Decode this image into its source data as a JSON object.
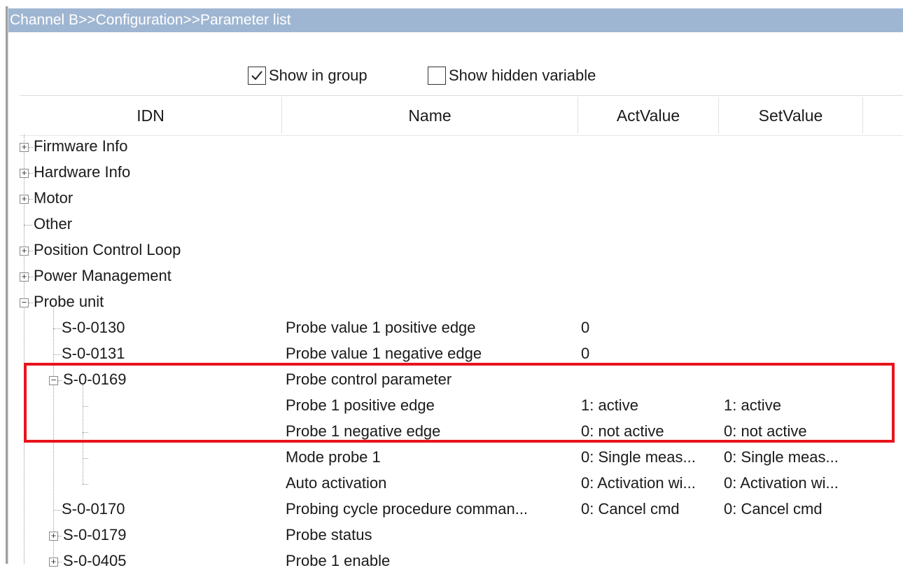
{
  "window": {
    "breadcrumb": "Channel B>>Configuration>>Parameter list"
  },
  "options": {
    "show_in_group": {
      "label": "Show in group",
      "checked": true
    },
    "show_hidden": {
      "label": "Show hidden variable",
      "checked": false
    }
  },
  "columns": {
    "idn": "IDN",
    "name": "Name",
    "act": "ActValue",
    "set": "SetValue"
  },
  "tree": {
    "firmware": {
      "label": "Firmware Info"
    },
    "hardware": {
      "label": "Hardware Info"
    },
    "motor": {
      "label": "Motor"
    },
    "other": {
      "label": "Other"
    },
    "position": {
      "label": "Position Control Loop"
    },
    "power": {
      "label": "Power Management"
    },
    "probe_unit": {
      "label": "Probe unit"
    },
    "s0130": {
      "idn": "S-0-0130",
      "name": "Probe value 1 positive edge",
      "act": "0",
      "set": ""
    },
    "s0131": {
      "idn": "S-0-0131",
      "name": "Probe value 1 negative edge",
      "act": "0",
      "set": ""
    },
    "s0169": {
      "idn": "S-0-0169",
      "name": "Probe control parameter",
      "act": "",
      "set": ""
    },
    "s0169_1": {
      "idn": "",
      "name": "Probe 1 positive edge",
      "act": "1: active",
      "set": "1: active"
    },
    "s0169_2": {
      "idn": "",
      "name": "Probe 1 negative edge",
      "act": "0: not active",
      "set": "0: not active"
    },
    "s0169_3": {
      "idn": "",
      "name": "Mode probe 1",
      "act": "0: Single meas...",
      "set": "0: Single meas..."
    },
    "s0169_4": {
      "idn": "",
      "name": "Auto activation",
      "act": "0: Activation wi...",
      "set": "0: Activation wi..."
    },
    "s0170": {
      "idn": "S-0-0170",
      "name": "Probing cycle procedure comman...",
      "act": "0: Cancel cmd",
      "set": "0: Cancel cmd"
    },
    "s0179": {
      "idn": "S-0-0179",
      "name": "Probe status",
      "act": "",
      "set": ""
    },
    "s0405": {
      "idn": "S-0-0405",
      "name": "Probe 1 enable",
      "act": "",
      "set": ""
    }
  },
  "icons": {
    "expand": "plus-box-icon",
    "collapse": "minus-box-icon",
    "check": "checkmark-icon"
  },
  "colors": {
    "title_bar": "#9fb6d2",
    "highlight": "#e8141c"
  }
}
